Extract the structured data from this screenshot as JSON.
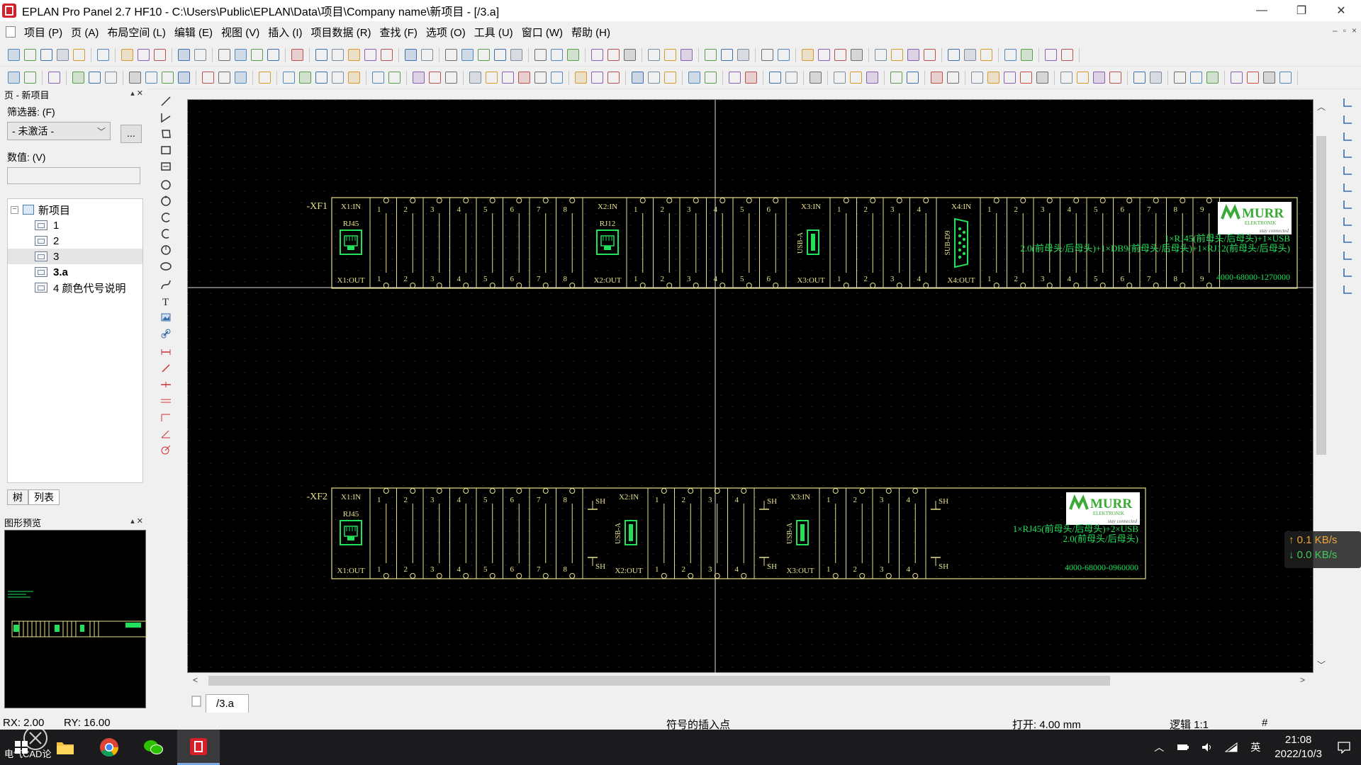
{
  "window": {
    "title": "EPLAN Pro Panel 2.7 HF10 - C:\\Users\\Public\\EPLAN\\Data\\项目\\Company name\\新项目 - [/3.a]",
    "minimize": "—",
    "restore": "❐",
    "close": "✕"
  },
  "menu": {
    "items": [
      "项目 (P)",
      "页 (A)",
      "布局空间 (L)",
      "编辑 (E)",
      "视图 (V)",
      "插入 (I)",
      "项目数据 (R)",
      "查找 (F)",
      "选项 (O)",
      "工具 (U)",
      "窗口 (W)",
      "帮助 (H)"
    ],
    "mdi_controls": [
      "–",
      "▫",
      "×"
    ]
  },
  "page_navigator": {
    "title": "页 - 新项目",
    "filter_label": "筛选器: (F)",
    "filter_value": "- 未激活 -",
    "more_button": "...",
    "value_label": "数值: (V)",
    "value_input": "",
    "tree": {
      "root": "新项目",
      "items": [
        "1",
        "2",
        "3",
        "3.a",
        "4 颜色代号说明"
      ],
      "selected": "3.a",
      "highlighted": "3"
    },
    "tabs": [
      "树",
      "列表"
    ],
    "active_tab": "树"
  },
  "preview": {
    "title": "图形预览"
  },
  "canvas": {
    "page_tab": "/3.a",
    "background": "#000000",
    "line_color": "#e5e08a",
    "symbol_color": "#22e05a",
    "modules": [
      {
        "tag": "-XF1",
        "connectors": [
          {
            "in": "X1:IN",
            "out": "X1:OUT",
            "type": "RJ45",
            "pins": [
              "1",
              "2",
              "3",
              "4",
              "5",
              "6",
              "7",
              "8"
            ]
          },
          {
            "in": "X2:IN",
            "out": "X2:OUT",
            "type": "RJ12",
            "pins": [
              "1",
              "2",
              "3",
              "4",
              "5",
              "6"
            ]
          },
          {
            "in": "X3:IN",
            "out": "X3:OUT",
            "type": "USB-A",
            "pins": [
              "1",
              "2",
              "3",
              "4"
            ]
          },
          {
            "in": "X4:IN",
            "out": "X4:OUT",
            "type": "SUB-D9",
            "pins": [
              "1",
              "2",
              "3",
              "4",
              "5",
              "6",
              "7",
              "8",
              "9"
            ]
          }
        ],
        "brand": "MURR",
        "brand_sub": "ELEKTRONIK",
        "brand_tag": "stay connected",
        "desc_line1": "1×RJ45(前母头/后母头)+1×USB",
        "desc_line2": "2.0(前母头/后母头)+1×DB9(前母头/后母头)+1×RJ12(前母头/后母头)",
        "part_no": "4000-68000-1270000"
      },
      {
        "tag": "-XF2",
        "connectors": [
          {
            "in": "X1:IN",
            "out": "X1:OUT",
            "type": "RJ45",
            "pins": [
              "1",
              "2",
              "3",
              "4",
              "5",
              "6",
              "7",
              "8"
            ],
            "shield": "SH"
          },
          {
            "in": "X2:IN",
            "out": "X2:OUT",
            "type": "USB-A",
            "pins": [
              "1",
              "2",
              "3",
              "4"
            ],
            "shield": "SH"
          },
          {
            "in": "X3:IN",
            "out": "X3:OUT",
            "type": "USB-A",
            "pins": [
              "1",
              "2",
              "3",
              "4"
            ],
            "shield": "SH"
          }
        ],
        "brand": "MURR",
        "brand_sub": "ELEKTRONIK",
        "brand_tag": "stay connected",
        "desc_line1": "1×RJ45(前母头/后母头)+2×USB",
        "desc_line2": "2.0(前母头/后母头)",
        "part_no": "4000-68000-0960000"
      }
    ]
  },
  "network": {
    "up": "↑ 0.1 KB/s",
    "down": "↓ 0.0 KB/s"
  },
  "status": {
    "rx": "RX: 2.00",
    "ry": "RY: 16.00",
    "hint": "符号的插入点",
    "open": "打开: 4.00 mm",
    "logic": "逻辑 1:1",
    "hash": "#"
  },
  "watermark": "电气CAD论",
  "taskbar": {
    "ime": "英",
    "time": "21:08",
    "date": "2022/10/3"
  }
}
